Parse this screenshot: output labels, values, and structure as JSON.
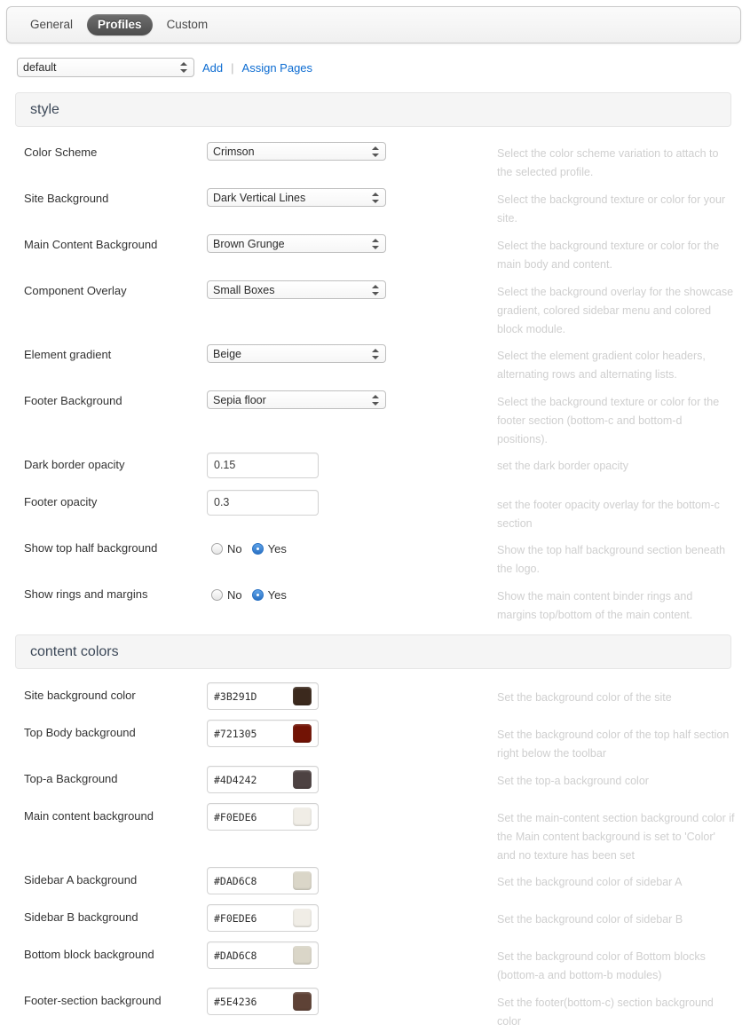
{
  "tabs": [
    {
      "label": "General",
      "active": false
    },
    {
      "label": "Profiles",
      "active": true
    },
    {
      "label": "Custom",
      "active": false
    }
  ],
  "profile_bar": {
    "select_value": "default",
    "add_label": "Add",
    "separator": "|",
    "assign_label": "Assign Pages"
  },
  "sections": [
    {
      "title": "style",
      "rows": [
        {
          "label": "Color Scheme",
          "type": "select",
          "value": "Crimson",
          "desc": "Select the color scheme variation to attach to the selected profile."
        },
        {
          "label": "Site Background",
          "type": "select",
          "value": "Dark Vertical Lines",
          "desc": "Select the background texture or color for your site."
        },
        {
          "label": "Main Content Background",
          "type": "select",
          "value": "Brown Grunge",
          "desc": "Select the background texture or color for the main body and content."
        },
        {
          "label": "Component Overlay",
          "type": "select",
          "value": "Small Boxes",
          "desc": "Select the background overlay for the showcase gradient, colored sidebar menu and colored block module."
        },
        {
          "label": "Element gradient",
          "type": "select",
          "value": "Beige",
          "desc": "Select the element gradient color headers, alternating rows and alternating lists."
        },
        {
          "label": "Footer Background",
          "type": "select",
          "value": "Sepia floor",
          "desc": "Select the background texture or color for the footer section (bottom-c and bottom-d positions)."
        },
        {
          "label": "Dark border opacity",
          "type": "text",
          "value": "0.15",
          "desc": "set the dark border opacity"
        },
        {
          "label": "Footer opacity",
          "type": "text",
          "value": "0.3",
          "desc": "set the footer opacity overlay for the bottom-c section"
        },
        {
          "label": "Show top half background",
          "type": "radio",
          "options": [
            "No",
            "Yes"
          ],
          "selected": "Yes",
          "desc": "Show the top half background section beneath the logo."
        },
        {
          "label": "Show rings and margins",
          "type": "radio",
          "options": [
            "No",
            "Yes"
          ],
          "selected": "Yes",
          "desc": "Show the main content binder rings and margins top/bottom of the main content."
        }
      ]
    },
    {
      "title": "content colors",
      "rows": [
        {
          "label": "Site background color",
          "type": "color",
          "value": "#3B291D",
          "desc": "Set the background color of the site"
        },
        {
          "label": "Top Body background",
          "type": "color",
          "value": "#721305",
          "desc": "Set the background color of the top half section right below the toolbar"
        },
        {
          "label": "Top-a Background",
          "type": "color",
          "value": "#4D4242",
          "desc": "Set the top-a background color"
        },
        {
          "label": "Main content background",
          "type": "color",
          "value": "#F0EDE6",
          "desc": "Set the main-content section background color if the Main content background is set to 'Color' and no texture has been set"
        },
        {
          "label": "Sidebar A background",
          "type": "color",
          "value": "#DAD6C8",
          "desc": "Set the background color of sidebar A"
        },
        {
          "label": "Sidebar B background",
          "type": "color",
          "value": "#F0EDE6",
          "desc": "Set the background color of sidebar B"
        },
        {
          "label": "Bottom block background",
          "type": "color",
          "value": "#DAD6C8",
          "desc": "Set the background color of Bottom blocks (bottom-a and bottom-b modules)"
        },
        {
          "label": "Footer-section background",
          "type": "color",
          "value": "#5E4236",
          "desc": "Set the footer(bottom-c) section background color"
        }
      ]
    }
  ],
  "colors": {
    "link": "#0b6bd1",
    "active_tab_bg": "#4d4d4d",
    "desc_text": "#cfcfcf",
    "section_header_bg": "#f5f5f5"
  }
}
